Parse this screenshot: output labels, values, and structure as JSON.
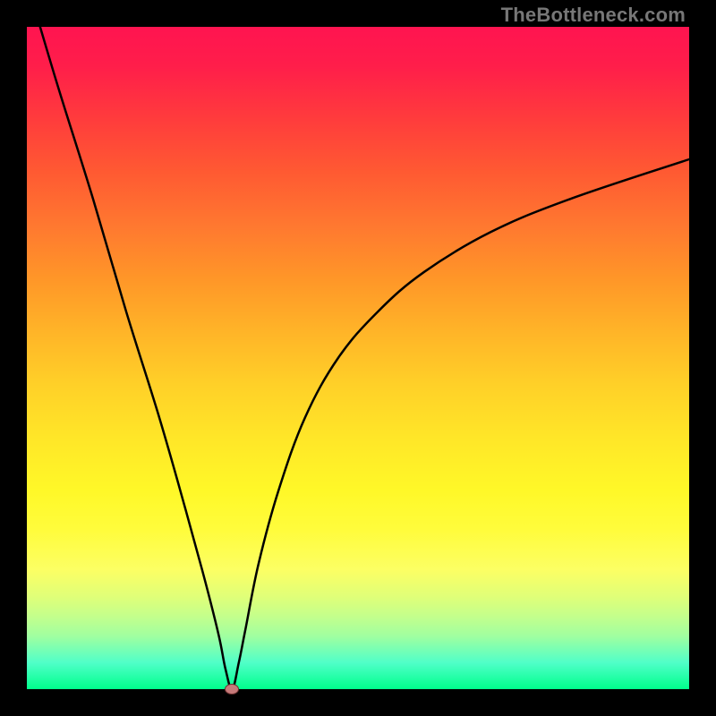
{
  "watermark": "TheBottleneck.com",
  "colors": {
    "frame_background": "#000000",
    "curve_stroke": "#000000",
    "marker_fill": "#c67a7a",
    "marker_stroke": "#6d3030",
    "watermark_text": "#777777"
  },
  "chart_data": {
    "type": "line",
    "title": "",
    "xlabel": "",
    "ylabel": "",
    "xlim": [
      0,
      100
    ],
    "ylim": [
      0,
      100
    ],
    "grid": false,
    "legend": false,
    "background_gradient": "red-yellow-green (top to bottom)",
    "series": [
      {
        "name": "bottleneck-curve",
        "description": "V-shaped curve reaching zero near x≈31 then rising asymptotically toward ~80",
        "x": [
          2,
          5,
          10,
          15,
          20,
          24,
          27,
          29,
          30,
          31,
          32,
          33,
          35,
          38,
          42,
          47,
          53,
          60,
          70,
          82,
          100
        ],
        "values": [
          100,
          90,
          74,
          57,
          41,
          27,
          16,
          8,
          3,
          0,
          4,
          9,
          19,
          30,
          41,
          50,
          57,
          63,
          69,
          74,
          80
        ]
      }
    ],
    "markers": [
      {
        "name": "optimal-point",
        "x": 31,
        "y": 0,
        "shape": "ellipse",
        "color": "#c67a7a"
      }
    ]
  }
}
